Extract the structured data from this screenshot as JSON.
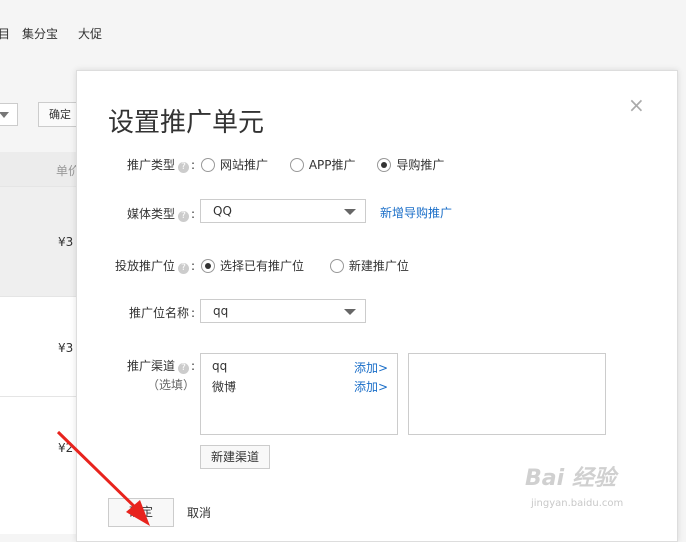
{
  "background": {
    "nav_items": [
      "目",
      "集分宝",
      "大促"
    ],
    "confirm_label": "确定",
    "table_header": "单价",
    "row_prices": [
      "¥3",
      "¥3",
      "¥2"
    ]
  },
  "modal": {
    "title": "设置推广单元",
    "close_glyph": "×",
    "promo_type": {
      "label": "推广类型",
      "options": [
        "网站推广",
        "APP推广",
        "导购推广"
      ],
      "selected": "导购推广"
    },
    "media_type": {
      "label": "媒体类型",
      "value": "QQ",
      "new_link": "新增导购推广"
    },
    "placement": {
      "label": "投放推广位",
      "options": [
        "选择已有推广位",
        "新建推广位"
      ],
      "selected": "选择已有推广位"
    },
    "placement_name": {
      "label": "推广位名称",
      "value": "qq"
    },
    "channel": {
      "label": "推广渠道",
      "optional": "（选填）",
      "items": [
        {
          "name": "qq",
          "action": "添加>"
        },
        {
          "name": "微博",
          "action": "添加>"
        }
      ],
      "new_button": "新建渠道"
    },
    "confirm_label": "确定",
    "cancel_label": "取消"
  },
  "watermark": {
    "logo": "Bai 经验",
    "url": "jingyan.baidu.com"
  }
}
